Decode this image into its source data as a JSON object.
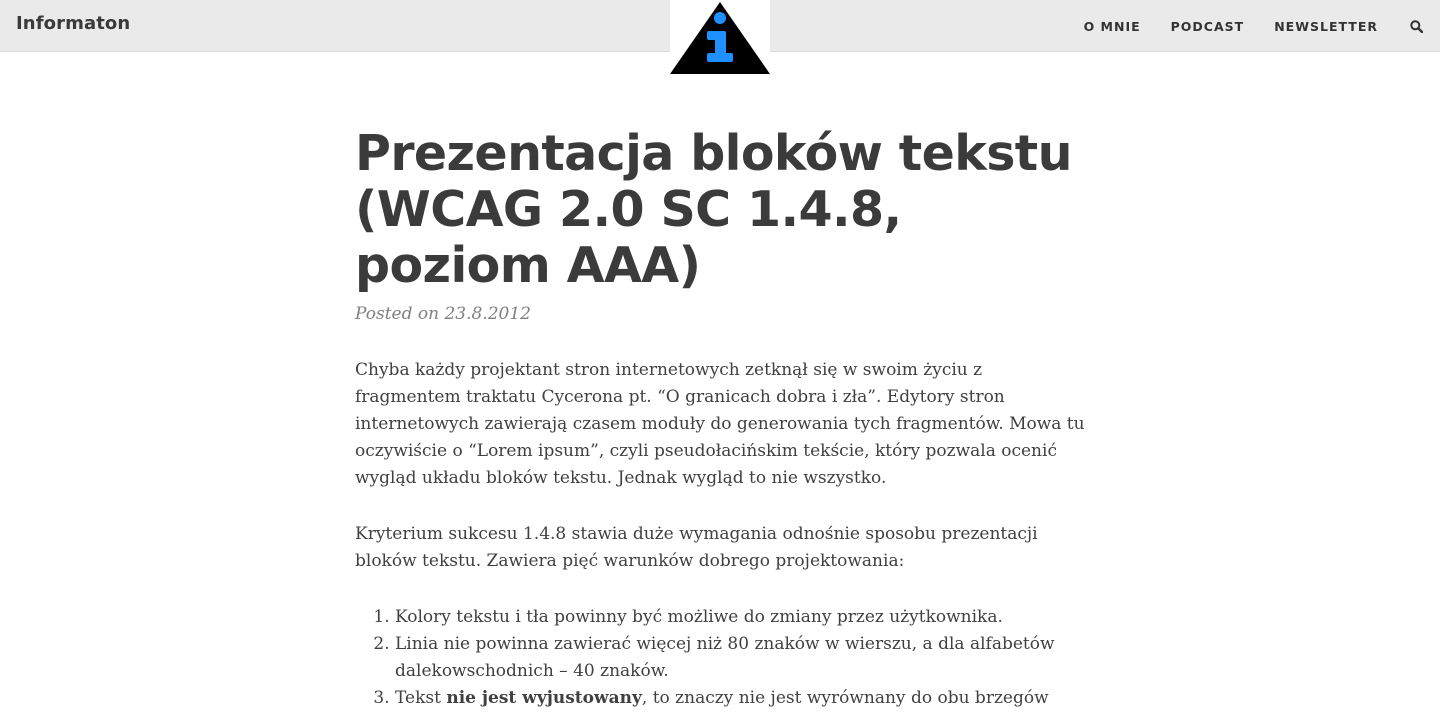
{
  "header": {
    "site_title": "Informaton",
    "nav": [
      {
        "label": "O MNIE"
      },
      {
        "label": "PODCAST"
      },
      {
        "label": "NEWSLETTER"
      }
    ],
    "search_icon": "search-icon",
    "logo_icon": "info-triangle-logo",
    "colors": {
      "header_bg": "#eaeaea",
      "logo_triangle": "#000000",
      "logo_info": "#1e90ff"
    }
  },
  "post": {
    "title": "Prezentacja bloków tekstu (WCAG 2.0 SC 1.4.8, poziom AAA)",
    "meta": "Posted on 23.8.2012",
    "paragraphs": [
      "Chyba każdy projektant stron internetowych zetknął się w swoim życiu z fragmentem traktatu Cycerona pt. “O granicach dobra i zła”. Edytory stron internetowych zawierają czasem moduły do generowania tych fragmentów. Mowa tu oczywiście o “Lorem ipsum”, czyli pseudołacińskim tekście, który pozwala ocenić wygląd układu bloków tekstu. Jednak wygląd to nie wszystko.",
      "Kryterium sukcesu 1.4.8 stawia duże wymagania odnośnie sposobu prezentacji bloków tekstu. Zawiera pięć warunków dobrego projektowania:"
    ],
    "list": [
      {
        "text": "Kolory tekstu i tła powinny być możliwe do zmiany przez użytkownika."
      },
      {
        "text": "Linia nie powinna zawierać więcej niż 80 znaków w wierszu, a dla alfabetów dalekowschodnich – 40 znaków."
      },
      {
        "prefix": "Tekst ",
        "strong": "nie jest wyjustowany",
        "suffix": ", to znaczy nie jest wyrównany do obu brzegów"
      }
    ]
  }
}
